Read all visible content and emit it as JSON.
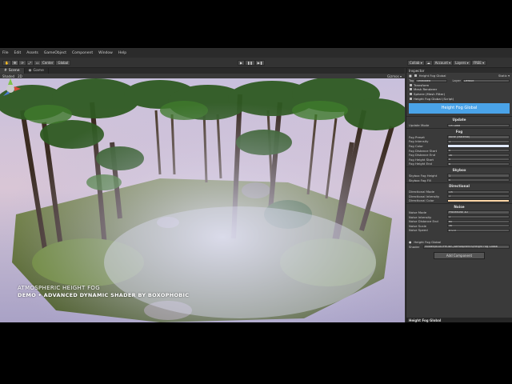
{
  "menu": [
    "File",
    "Edit",
    "Assets",
    "GameObject",
    "Component",
    "Window",
    "Help"
  ],
  "toolbar": {
    "tools": [
      "✋",
      "✥",
      "⟳",
      "⤢",
      "▭"
    ],
    "pivot": "Center",
    "space": "Global",
    "play": "▶",
    "pause": "❚❚",
    "step": "▶❚",
    "collab": "Collab ▾",
    "account": "Account ▾",
    "layers": "Layers ▾",
    "layout": "FREE ▾"
  },
  "scene_tabs": {
    "scene": "Scene",
    "game": "Game"
  },
  "scene_toolbar": {
    "shaded": "Shaded",
    "mode": "2D",
    "gizmos": "Gizmos ▾"
  },
  "captions": {
    "line1": "ATMOSPHERIC HEIGHT FOG",
    "line2": "DEMO • ADVANCED DYNAMIC SHADER BY BOXOPHOBIC"
  },
  "inspector": {
    "tab": "Inspector",
    "object_name": "Height Fog Global",
    "static": "Static ▾",
    "tag_label": "Tag",
    "tag_value": "Untagged",
    "layer_label": "Layer",
    "layer_value": "Default",
    "components": [
      "Transform",
      "Mesh Renderer",
      "Sphere (Mesh Filter)",
      "Height Fog Global (Script)"
    ],
    "banner": "Height Fog Global",
    "sections": {
      "update": "Update",
      "fog": "Fog",
      "skybox": "Skybox",
      "directional": "Directional",
      "noise": "Noise"
    },
    "update_rows": [
      {
        "label": "Update Mode",
        "value": "On Load"
      }
    ],
    "fog_preset": {
      "label": "Fog Preset",
      "value": "None (Material)"
    },
    "fog_rows": [
      {
        "label": "Fog Intensity",
        "value": "1"
      },
      {
        "label": "Fog Color",
        "value": ""
      },
      {
        "label": "Fog Distance Start",
        "value": "0"
      },
      {
        "label": "Fog Distance End",
        "value": "30"
      },
      {
        "label": "Fog Height Start",
        "value": "0"
      },
      {
        "label": "Fog Height End",
        "value": "8"
      }
    ],
    "skybox_rows": [
      {
        "label": "Skybox Fog Height",
        "value": "1"
      },
      {
        "label": "Skybox Fog Fill",
        "value": "0"
      }
    ],
    "directional_rows": [
      {
        "label": "Directional Mode",
        "value": "On"
      },
      {
        "label": "Directional Intensity",
        "value": "1"
      },
      {
        "label": "Directional Color",
        "value": ""
      }
    ],
    "noise_rows": [
      {
        "label": "Noise Mode",
        "value": "Procedural 3D"
      },
      {
        "label": "Noise Intensity",
        "value": "1"
      },
      {
        "label": "Noise Distance End",
        "value": "60"
      },
      {
        "label": "Noise Scale",
        "value": "30"
      },
      {
        "label": "Noise Speed",
        "value": "X 0.5"
      }
    ],
    "material_name": "Height Fog Global",
    "shader_label": "Shader",
    "shader_value": "Hidden/BOXOPHOBIC/Atmospherics/Height Fog Global",
    "add_component": "Add Component",
    "preview_title": "Height Fog Global"
  },
  "colors": {
    "banner": "#4aa3e8",
    "fog_color": "#dfe8ff",
    "directional_color": "#ffd7a8",
    "sky_top": "#c8c0dc",
    "sky_bottom": "#a9a2c6"
  },
  "icons": [
    "hand-icon",
    "move-icon",
    "rotate-icon",
    "scale-icon",
    "rect-icon",
    "play-icon",
    "pause-icon",
    "step-icon",
    "scene-gizmo-icon",
    "cloud-icon",
    "lock-icon",
    "settings-icon",
    "cube-icon"
  ]
}
